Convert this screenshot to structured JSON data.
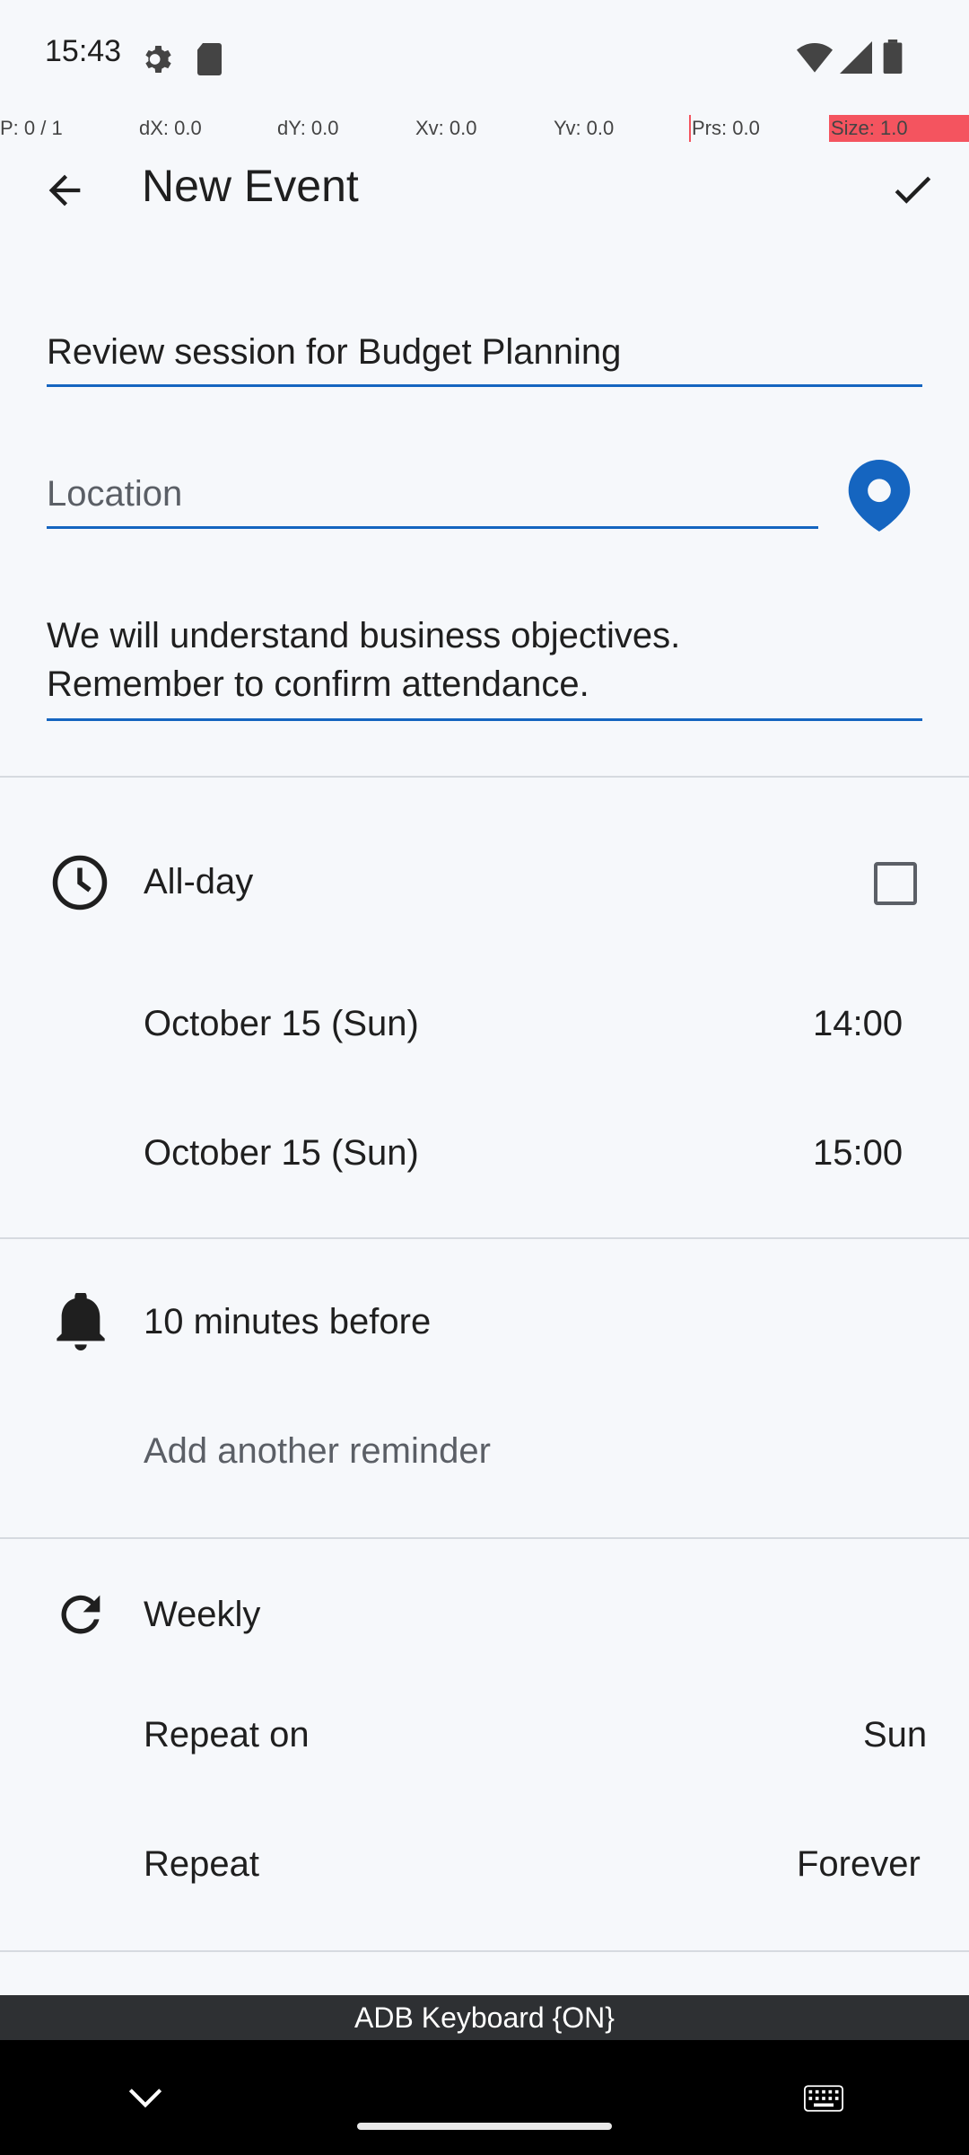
{
  "status_bar": {
    "time": "15:43"
  },
  "debug_overlay": {
    "p": "P: 0 / 1",
    "dx": "dX: 0.0",
    "dy": "dY: 0.0",
    "xv": "Xv: 0.0",
    "yv": "Yv: 0.0",
    "prs": "Prs: 0.0",
    "size": "Size: 1.0"
  },
  "toolbar": {
    "title": "New Event"
  },
  "form": {
    "title_value": "Review session for Budget Planning",
    "location_placeholder": "Location",
    "description_line1": "We will understand business objectives.",
    "description_line2": "Remember to confirm attendance."
  },
  "all_day": {
    "label": "All-day",
    "checked": false
  },
  "start": {
    "date": "October 15 (Sun)",
    "time": "14:00"
  },
  "end": {
    "date": "October 15 (Sun)",
    "time": "15:00"
  },
  "reminder": {
    "label": "10 minutes before",
    "add_label": "Add another reminder"
  },
  "repeat": {
    "frequency": "Weekly",
    "repeat_on_label": "Repeat on",
    "repeat_on_value": "Sun",
    "repeat_label": "Repeat",
    "repeat_value": "Forever"
  },
  "keyboard": {
    "label": "ADB Keyboard {ON}"
  },
  "colors": {
    "accent": "#1565C0",
    "background": "#F6F8FB"
  }
}
